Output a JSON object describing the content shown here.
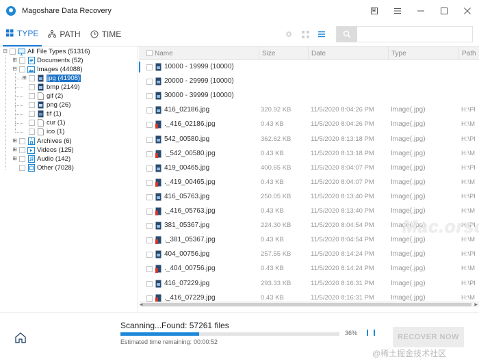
{
  "window": {
    "title": "Magoshare Data Recovery",
    "buttons": [
      "bookmark-icon",
      "menu-icon",
      "minimize-icon",
      "maximize-icon",
      "close-icon"
    ]
  },
  "toolbar": {
    "tabs": [
      {
        "label": "TYPE",
        "icon": "grid-icon",
        "active": true
      },
      {
        "label": "PATH",
        "icon": "tree-icon",
        "active": false
      },
      {
        "label": "TIME",
        "icon": "clock-icon",
        "active": false
      }
    ],
    "view_icons": [
      "preview-eye-icon",
      "thumbnail-view-icon",
      "list-view-icon"
    ],
    "search": {
      "placeholder": "",
      "value": ""
    }
  },
  "tree": [
    {
      "label": "All File Types (51316)",
      "level": 0,
      "expander": "-",
      "icon": "monitor-icon"
    },
    {
      "label": "Documents (52)",
      "level": 1,
      "expander": "+",
      "icon": "document-icon"
    },
    {
      "label": "Images (44088)",
      "level": 1,
      "expander": "-",
      "icon": "image-icon"
    },
    {
      "label": "jpg (41908)",
      "level": 2,
      "expander": "+",
      "icon": "jpg-file-icon",
      "selected": true
    },
    {
      "label": "bmp (2149)",
      "level": 2,
      "expander": "",
      "icon": "bmp-file-icon"
    },
    {
      "label": "gif (2)",
      "level": 2,
      "expander": "",
      "icon": "file-icon"
    },
    {
      "label": "png (26)",
      "level": 2,
      "expander": "",
      "icon": "png-file-icon"
    },
    {
      "label": "tif (1)",
      "level": 2,
      "expander": "",
      "icon": "tif-file-icon"
    },
    {
      "label": "cur (1)",
      "level": 2,
      "expander": "",
      "icon": "file-icon"
    },
    {
      "label": "ico (1)",
      "level": 2,
      "expander": "",
      "icon": "file-icon"
    },
    {
      "label": "Archives (6)",
      "level": 1,
      "expander": "+",
      "icon": "archive-icon"
    },
    {
      "label": "Videos (125)",
      "level": 1,
      "expander": "+",
      "icon": "video-icon"
    },
    {
      "label": "Audio (142)",
      "level": 1,
      "expander": "+",
      "icon": "audio-icon"
    },
    {
      "label": "Other (7028)",
      "level": 1,
      "expander": "",
      "icon": "other-icon"
    }
  ],
  "list": {
    "columns": [
      "Name",
      "Size",
      "Date",
      "Type",
      "Path"
    ],
    "rows": [
      {
        "name": "10000 - 19999 (10000)",
        "size": "",
        "date": "",
        "type": "",
        "path": "",
        "kind": "folder"
      },
      {
        "name": "20000 - 29999 (10000)",
        "size": "",
        "date": "",
        "type": "",
        "path": "",
        "kind": "folder"
      },
      {
        "name": "30000 - 39999 (10000)",
        "size": "",
        "date": "",
        "type": "",
        "path": "",
        "kind": "folder"
      },
      {
        "name": "416_02186.jpg",
        "size": "320.92 KB",
        "date": "11/5/2020 8:04:26 PM",
        "type": "Image(.jpg)",
        "path": "H:\\Pl",
        "kind": "image"
      },
      {
        "name": "._416_02186.jpg",
        "size": "0.43 KB",
        "date": "11/5/2020 8:04:26 PM",
        "type": "Image(.jpg)",
        "path": "H:\\M",
        "kind": "broken"
      },
      {
        "name": "542_00580.jpg",
        "size": "362.62 KB",
        "date": "11/5/2020 8:13:18 PM",
        "type": "Image(.jpg)",
        "path": "H:\\Pl",
        "kind": "image"
      },
      {
        "name": "._542_00580.jpg",
        "size": "0.43 KB",
        "date": "11/5/2020 8:13:18 PM",
        "type": "Image(.jpg)",
        "path": "H:\\M",
        "kind": "broken"
      },
      {
        "name": "419_00465.jpg",
        "size": "400.65 KB",
        "date": "11/5/2020 8:04:07 PM",
        "type": "Image(.jpg)",
        "path": "H:\\Pl",
        "kind": "image"
      },
      {
        "name": "._419_00465.jpg",
        "size": "0.43 KB",
        "date": "11/5/2020 8:04:07 PM",
        "type": "Image(.jpg)",
        "path": "H:\\M",
        "kind": "broken"
      },
      {
        "name": "416_05763.jpg",
        "size": "250.05 KB",
        "date": "11/5/2020 8:13:40 PM",
        "type": "Image(.jpg)",
        "path": "H:\\Pl",
        "kind": "image"
      },
      {
        "name": "._416_05763.jpg",
        "size": "0.43 KB",
        "date": "11/5/2020 8:13:40 PM",
        "type": "Image(.jpg)",
        "path": "H:\\M",
        "kind": "broken"
      },
      {
        "name": "381_05367.jpg",
        "size": "224.30 KB",
        "date": "11/5/2020 8:04:54 PM",
        "type": "Image(.jpg)",
        "path": "H:\\Pl",
        "kind": "image"
      },
      {
        "name": "._381_05367.jpg",
        "size": "0.43 KB",
        "date": "11/5/2020 8:04:54 PM",
        "type": "Image(.jpg)",
        "path": "H:\\M",
        "kind": "broken"
      },
      {
        "name": "404_00756.jpg",
        "size": "257.55 KB",
        "date": "11/5/2020 8:14:24 PM",
        "type": "Image(.jpg)",
        "path": "H:\\Pl",
        "kind": "image"
      },
      {
        "name": "._404_00756.jpg",
        "size": "0.43 KB",
        "date": "11/5/2020 8:14:24 PM",
        "type": "Image(.jpg)",
        "path": "H:\\M",
        "kind": "broken"
      },
      {
        "name": "416_07229.jpg",
        "size": "293.33 KB",
        "date": "11/5/2020 8:16:31 PM",
        "type": "Image(.jpg)",
        "path": "H:\\Pl",
        "kind": "image"
      },
      {
        "name": "._416_07229.jpg",
        "size": "0.43 KB",
        "date": "11/5/2020 8:16:31 PM",
        "type": "Image(.jpg)",
        "path": "H:\\M",
        "kind": "broken"
      }
    ]
  },
  "watermark": "Mac.orsoon.com",
  "bottom": {
    "scan_text": "Scanning...Found: 57261 files",
    "progress_percent": 36,
    "progress_label": "36%",
    "est_label": "Estimated time remaining:",
    "est_value": "00:00:52",
    "recover_label": "RECOVER NOW",
    "watermark2": "@稀土掘金技术社区"
  },
  "colors": {
    "accent": "#1e88d8",
    "selection": "#1e73c8",
    "broken_icon": "#d0362f"
  }
}
